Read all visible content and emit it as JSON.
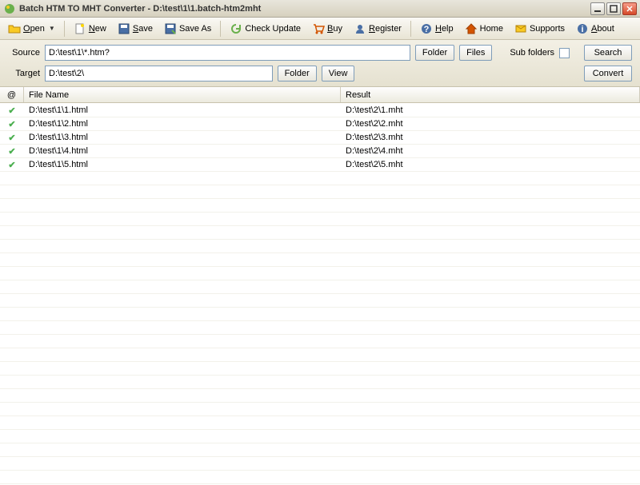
{
  "title": "Batch HTM TO MHT Converter - D:\\test\\1\\1.batch-htm2mht",
  "toolbar": {
    "open": "Open",
    "new": "New",
    "save": "Save",
    "saveas": "Save As",
    "check": "Check Update",
    "buy": "Buy",
    "register": "Register",
    "help": "Help",
    "home": "Home",
    "supports": "Supports",
    "about": "About"
  },
  "paths": {
    "source_label": "Source",
    "source_value": "D:\\test\\1\\*.htm?",
    "target_label": "Target",
    "target_value": "D:\\test\\2\\",
    "folder": "Folder",
    "files": "Files",
    "view": "View",
    "subfolders": "Sub folders",
    "search": "Search",
    "convert": "Convert"
  },
  "headers": {
    "at": "@",
    "filename": "File Name",
    "result": "Result"
  },
  "rows": [
    {
      "file": "D:\\test\\1\\1.html",
      "result": "D:\\test\\2\\1.mht"
    },
    {
      "file": "D:\\test\\1\\2.html",
      "result": "D:\\test\\2\\2.mht"
    },
    {
      "file": "D:\\test\\1\\3.html",
      "result": "D:\\test\\2\\3.mht"
    },
    {
      "file": "D:\\test\\1\\4.html",
      "result": "D:\\test\\2\\4.mht"
    },
    {
      "file": "D:\\test\\1\\5.html",
      "result": "D:\\test\\2\\5.mht"
    }
  ]
}
